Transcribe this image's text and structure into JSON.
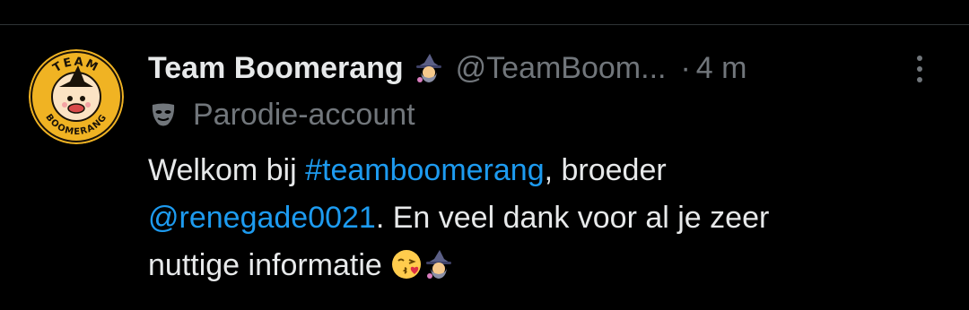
{
  "tweet": {
    "display_name": "Team Boomerang",
    "name_emoji": "witch-emoji",
    "handle": "@TeamBoom...",
    "separator": "·",
    "time": "4 m",
    "label": "Parodie-account",
    "label_icon": "mask-icon",
    "text": {
      "part1": "Welkom bij ",
      "hashtag": "#teamboomerang",
      "part2": ", broeder",
      "mention": "@renegade0021",
      "part3": ". En veel dank voor al je zeer",
      "part4": "nuttige informatie ",
      "emojis": [
        "kissing-face-emoji",
        "witch-emoji"
      ]
    }
  },
  "avatar": {
    "top_text": "TEAM",
    "bottom_text": "BOOMERANG"
  },
  "colors": {
    "background": "#000000",
    "primary_text": "#e7e9ea",
    "secondary_text": "#71767b",
    "link": "#1d9bf0",
    "divider": "#2f3336",
    "avatar_gold": "#f0b323"
  }
}
